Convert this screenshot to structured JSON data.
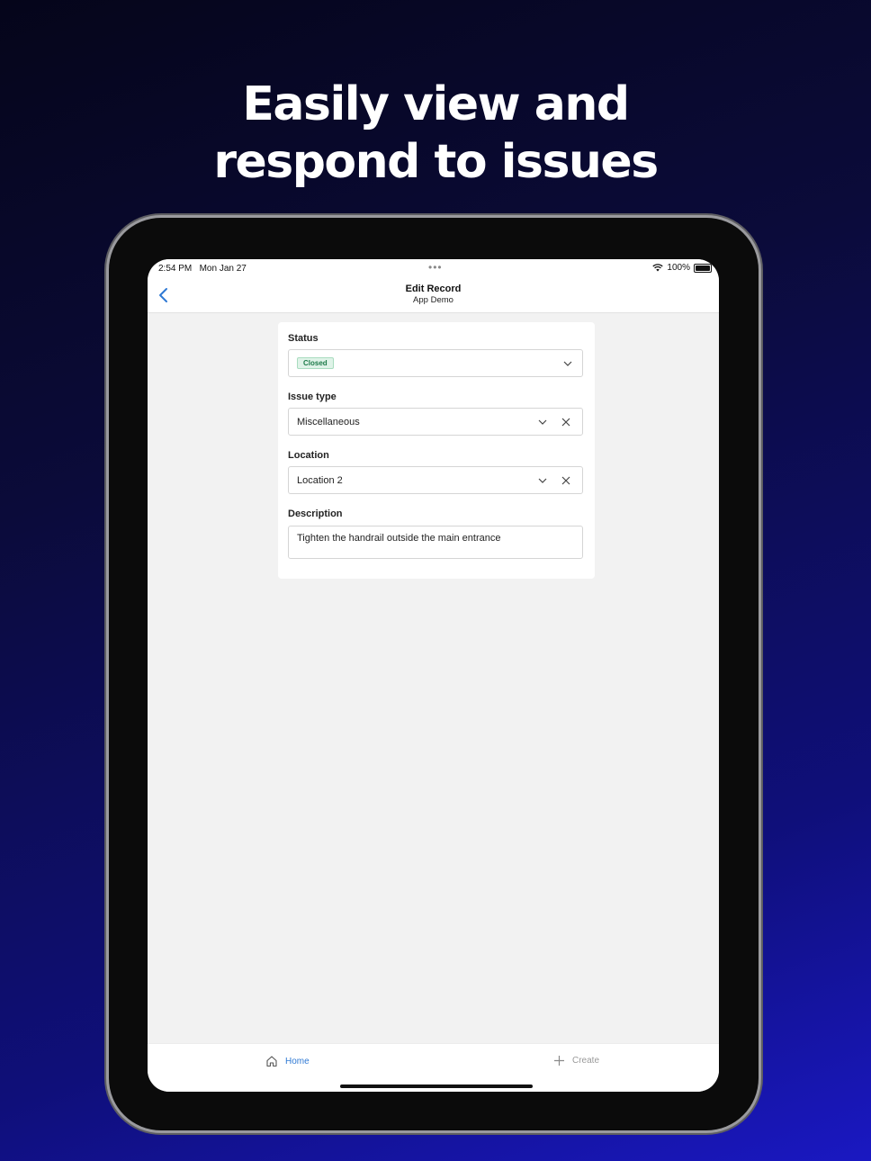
{
  "headline": {
    "line1": "Easily view and",
    "line2": "respond to issues"
  },
  "status_bar": {
    "time": "2:54 PM",
    "date": "Mon Jan 27",
    "dots": "•••",
    "battery": "100%"
  },
  "nav": {
    "title": "Edit Record",
    "subtitle": "App Demo"
  },
  "form": {
    "status": {
      "label": "Status",
      "value": "Closed",
      "badge_color": "#1c7a49"
    },
    "issue_type": {
      "label": "Issue type",
      "value": "Miscellaneous"
    },
    "location": {
      "label": "Location",
      "value": "Location 2"
    },
    "description": {
      "label": "Description",
      "value": "Tighten the handrail outside the main entrance"
    }
  },
  "tabs": {
    "home": "Home",
    "create": "Create"
  },
  "colors": {
    "accent": "#2f79d4",
    "inactive_tab": "#9a9a9a"
  },
  "icons": {
    "back": "chevron-left-icon",
    "dropdown": "chevron-down-icon",
    "clear": "close-icon",
    "home": "home-icon",
    "create": "plus-icon",
    "wifi": "wifi-icon",
    "battery": "battery-icon"
  }
}
